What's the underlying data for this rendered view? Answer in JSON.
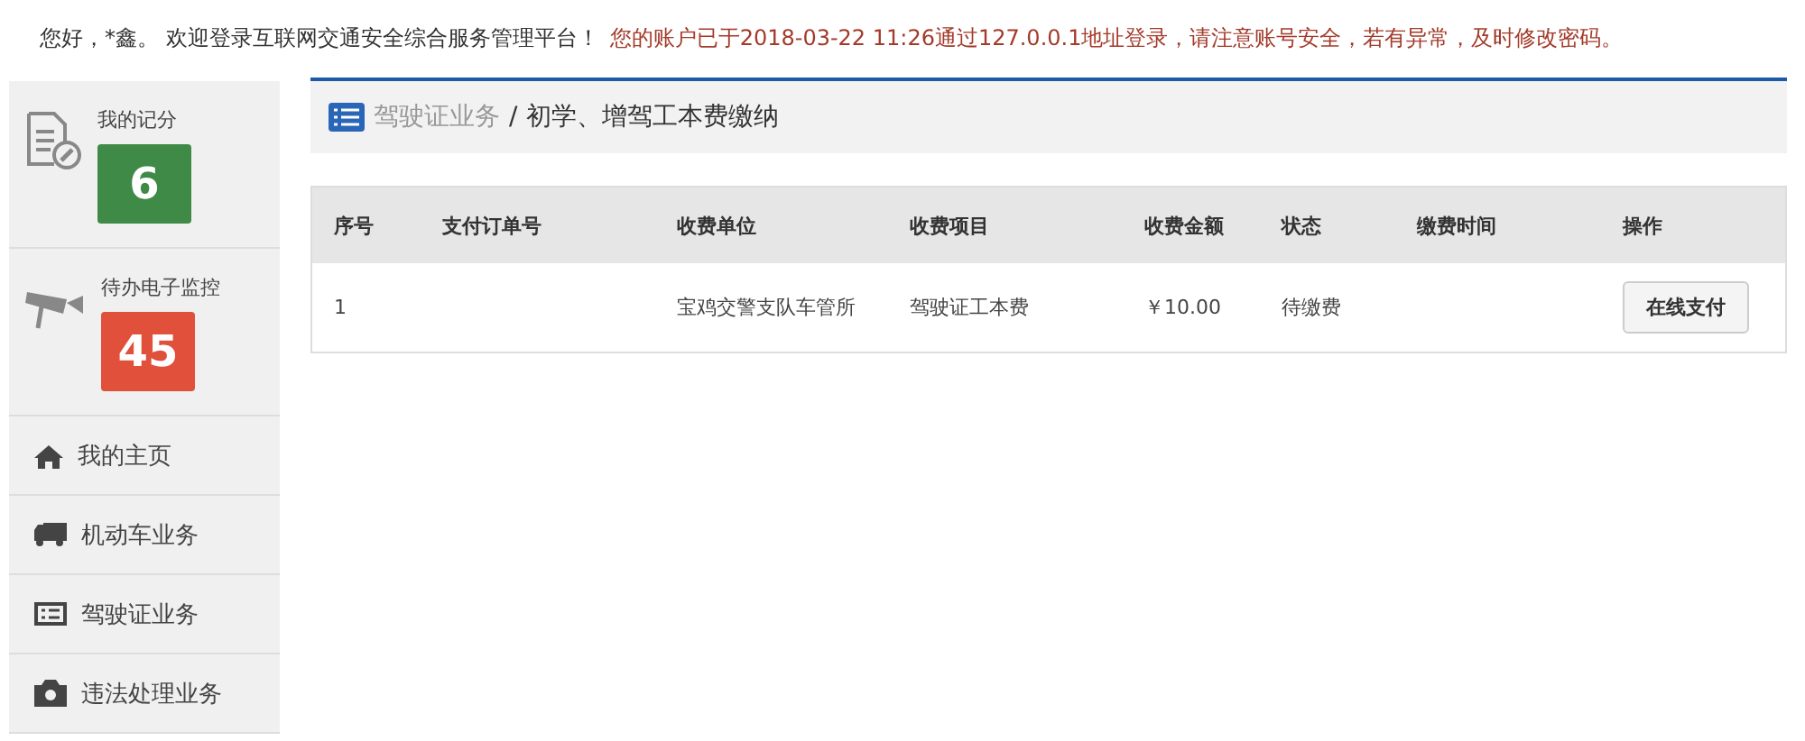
{
  "top_bar": {
    "greeting": "您好，*鑫。 欢迎登录互联网交通安全综合服务管理平台！",
    "notice": "您的账户已于2018-03-22 11:26通过127.0.0.1地址登录，请注意账号安全，若有异常，及时修改密码。"
  },
  "sidebar": {
    "stats": [
      {
        "kind": "score",
        "label": "我的记分",
        "count": "6",
        "color": "#3e8a46"
      },
      {
        "kind": "camera",
        "label": "待办电子监控",
        "count": "45",
        "color": "#e0503a"
      }
    ],
    "items": [
      {
        "kind": "home",
        "label": "我的主页"
      },
      {
        "kind": "truck",
        "label": "机动车业务"
      },
      {
        "kind": "list",
        "label": "驾驶证业务"
      },
      {
        "kind": "camera",
        "label": "违法处理业务"
      }
    ]
  },
  "breadcrumb": {
    "parent": "驾驶证业务",
    "separator": "/",
    "current": "初学、增驾工本费缴纳"
  },
  "table": {
    "columns": [
      "序号",
      "支付订单号",
      "收费单位",
      "收费项目",
      "收费金额",
      "状态",
      "缴费时间",
      "操作"
    ],
    "rows": [
      {
        "cells": [
          "1",
          "",
          "宝鸡交警支队车管所",
          "驾驶证工本费",
          "￥10.00",
          "待缴费",
          ""
        ],
        "action": "在线支付"
      }
    ]
  }
}
